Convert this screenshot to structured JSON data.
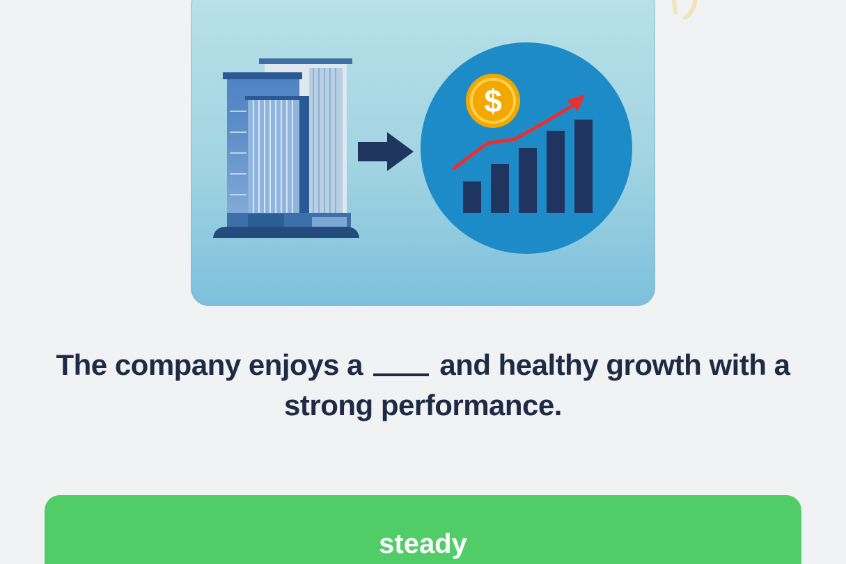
{
  "question": {
    "part1": "The company enjoys a",
    "part2": "and healthy growth with a",
    "part3": "strong performance."
  },
  "answer_option": {
    "label": "steady"
  },
  "illustration": {
    "icons": [
      "office-building-icon",
      "arrow-right-icon",
      "dollar-coin-icon",
      "growth-chart-icon"
    ],
    "colors": {
      "card_top": "#b9e1e8",
      "card_bottom": "#7dc0dc",
      "circle": "#1e8bc9",
      "bars": "#1f3560",
      "trend_arrow": "#e8312f",
      "coin": "#f2a800"
    }
  },
  "colors": {
    "background": "#f1f2f4",
    "text": "#1f2a44",
    "button": "#51cd67",
    "button_text": "#ffffff"
  }
}
